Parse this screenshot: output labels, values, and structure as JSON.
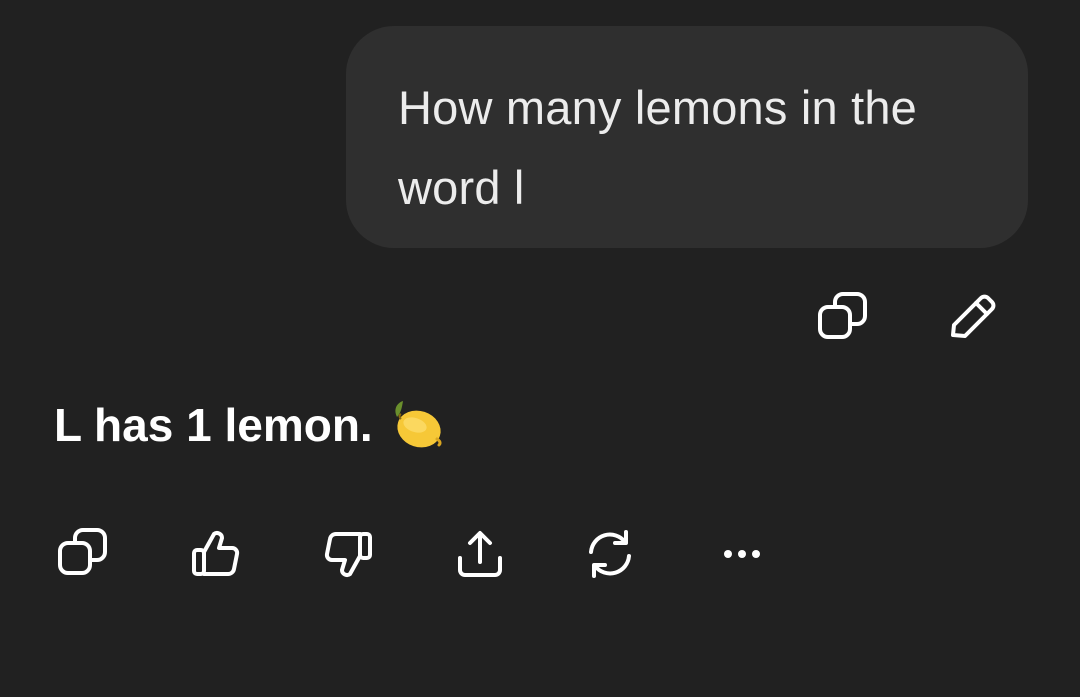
{
  "user_message": {
    "line1": "How many lemons in the",
    "line2": "word l"
  },
  "user_actions": [
    {
      "icon": "copy-icon"
    },
    {
      "icon": "edit-icon"
    }
  ],
  "assistant_message": {
    "text": "L has 1 lemon.",
    "emoji": "lemon-emoji"
  },
  "assistant_actions": [
    {
      "icon": "copy-icon"
    },
    {
      "icon": "thumbs-up-icon"
    },
    {
      "icon": "thumbs-down-icon"
    },
    {
      "icon": "share-icon"
    },
    {
      "icon": "regenerate-icon"
    },
    {
      "icon": "more-icon"
    }
  ],
  "colors": {
    "background": "#212121",
    "bubble": "#2f2f2f",
    "text": "#ffffff",
    "lemon": "#f6c837"
  }
}
